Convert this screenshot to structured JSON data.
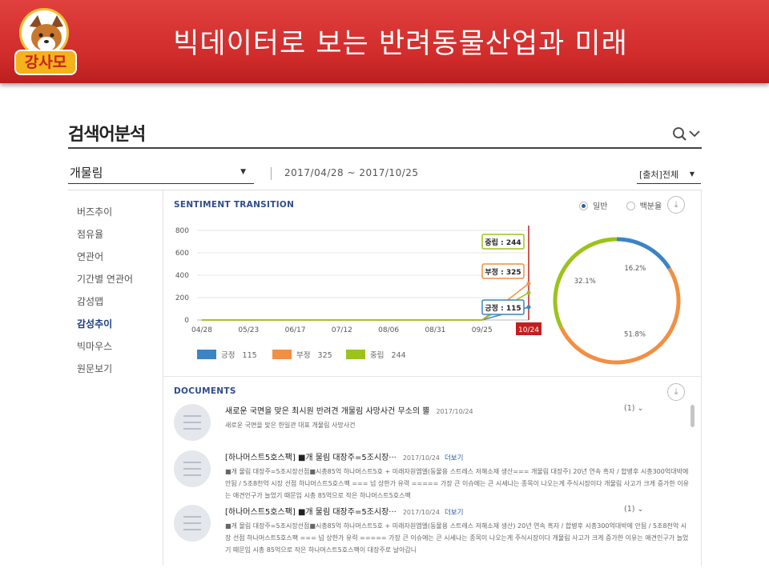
{
  "banner": {
    "title": "빅데이터로 보는 반려동물산업과 미래",
    "logo_text": "강사모"
  },
  "page": {
    "title": "검색어분석"
  },
  "filter": {
    "keyword": "개물림",
    "date_range": "2017/04/28 ~ 2017/10/25",
    "source": "[출처]전체"
  },
  "nav": {
    "items": [
      "버즈추이",
      "점유율",
      "연관어",
      "기간별 연관어",
      "감성맵",
      "감성추이",
      "빅마우스",
      "원문보기"
    ],
    "active": "감성추이"
  },
  "sentiment": {
    "section_label": "SENTIMENT TRANSITION",
    "radio": {
      "general": "일반",
      "percent": "백분율",
      "selected": "일반"
    },
    "tooltips": {
      "neutral": "중립 : 244",
      "negative": "부정 : 325",
      "positive": "긍정 : 115"
    },
    "legend": [
      {
        "name": "긍정",
        "value": "115"
      },
      {
        "name": "부정",
        "value": "325"
      },
      {
        "name": "중립",
        "value": "244"
      }
    ],
    "donut_labels": {
      "positive": "16.2%",
      "negative": "51.8%",
      "neutral": "32.1%"
    }
  },
  "chart_data": [
    {
      "type": "line",
      "x": [
        "04/28",
        "05/23",
        "06/17",
        "07/12",
        "08/06",
        "08/31",
        "09/25",
        "10/24"
      ],
      "ylim": [
        0,
        800
      ],
      "yticks": [
        "800",
        "600",
        "400",
        "200",
        "0"
      ],
      "highlight_x": "10/24",
      "series": [
        {
          "name": "긍정",
          "values": [
            0,
            0,
            0,
            0,
            0,
            0,
            0,
            115
          ]
        },
        {
          "name": "부정",
          "values": [
            0,
            0,
            0,
            0,
            0,
            0,
            0,
            325
          ]
        },
        {
          "name": "중립",
          "values": [
            0,
            0,
            0,
            0,
            0,
            0,
            0,
            244
          ]
        }
      ],
      "colors": {
        "긍정": "#3c84c4",
        "부정": "#f28f43",
        "중립": "#9cc31c"
      }
    },
    {
      "type": "pie",
      "categories": [
        "긍정",
        "부정",
        "중립"
      ],
      "values": [
        16.2,
        51.8,
        32.1
      ],
      "colors": [
        "#3c84c4",
        "#f28f43",
        "#9cc31c"
      ]
    }
  ],
  "documents": {
    "section_label": "DOCUMENTS",
    "items": [
      {
        "title": "새로운 국면을 맞은 최시원 반려견 개물림 사망사건   무소의 뿔",
        "date": "2017/10/24",
        "more": "",
        "count": "(1)",
        "body": "새로운 국면을 맞은 한일관 대표 개물림 사망사건"
      },
      {
        "title": "[하나머스트5호스팩] ■개 물림 대장주=5조시장···",
        "date": "2017/10/24",
        "more": "더보기",
        "count": "",
        "body": "■개 물림 대장주=5조시장선점■시총85억 하나머스트5호 + 미래자원엠엘(동물용 스트레스 저해소재 생산=== 개물림 대장주) 20년 연속 흑자 / 합병후 시총300억대박에 안됨 / 5조8천억 시장 선점 하나머스트5호스팩 === 넘 상한가 유력 ===== 가장 큰 이슈에는 큰 시세나는 종목이 나오는게 주식시장이다 개물림 사고가 크게 증가한 이유는 애견인구가 늘었기 때문임 시총 85억으로 작은 하나머스트5호스팩"
      },
      {
        "title": "[하나머스트5호스팩] ■개 물림 대장주=5조시장···",
        "date": "2017/10/24",
        "more": "더보기",
        "count": "(1)",
        "body": "■개 물림 대장주=5조시장선점■시총85억 하나머스트5호 + 미래자원엠엘(동물용 스트레스 저해소재 생산) 20년 연속 흑자 / 합병후 시총300억대박에 안됨 / 5조8천억 시장 선점 하나머스트5호스팩 === 넘 상한가 유력 ===== 가장 큰 이슈에는 큰 시세나는 종목이 나오는게 주식시장이다 개물림 사고가 크게 증가한 이유는 애견인구가 늘었기 때문임 시총 85억으로 작은 하나머스트5호스팩이 대장주로 날아갑니"
      }
    ]
  }
}
